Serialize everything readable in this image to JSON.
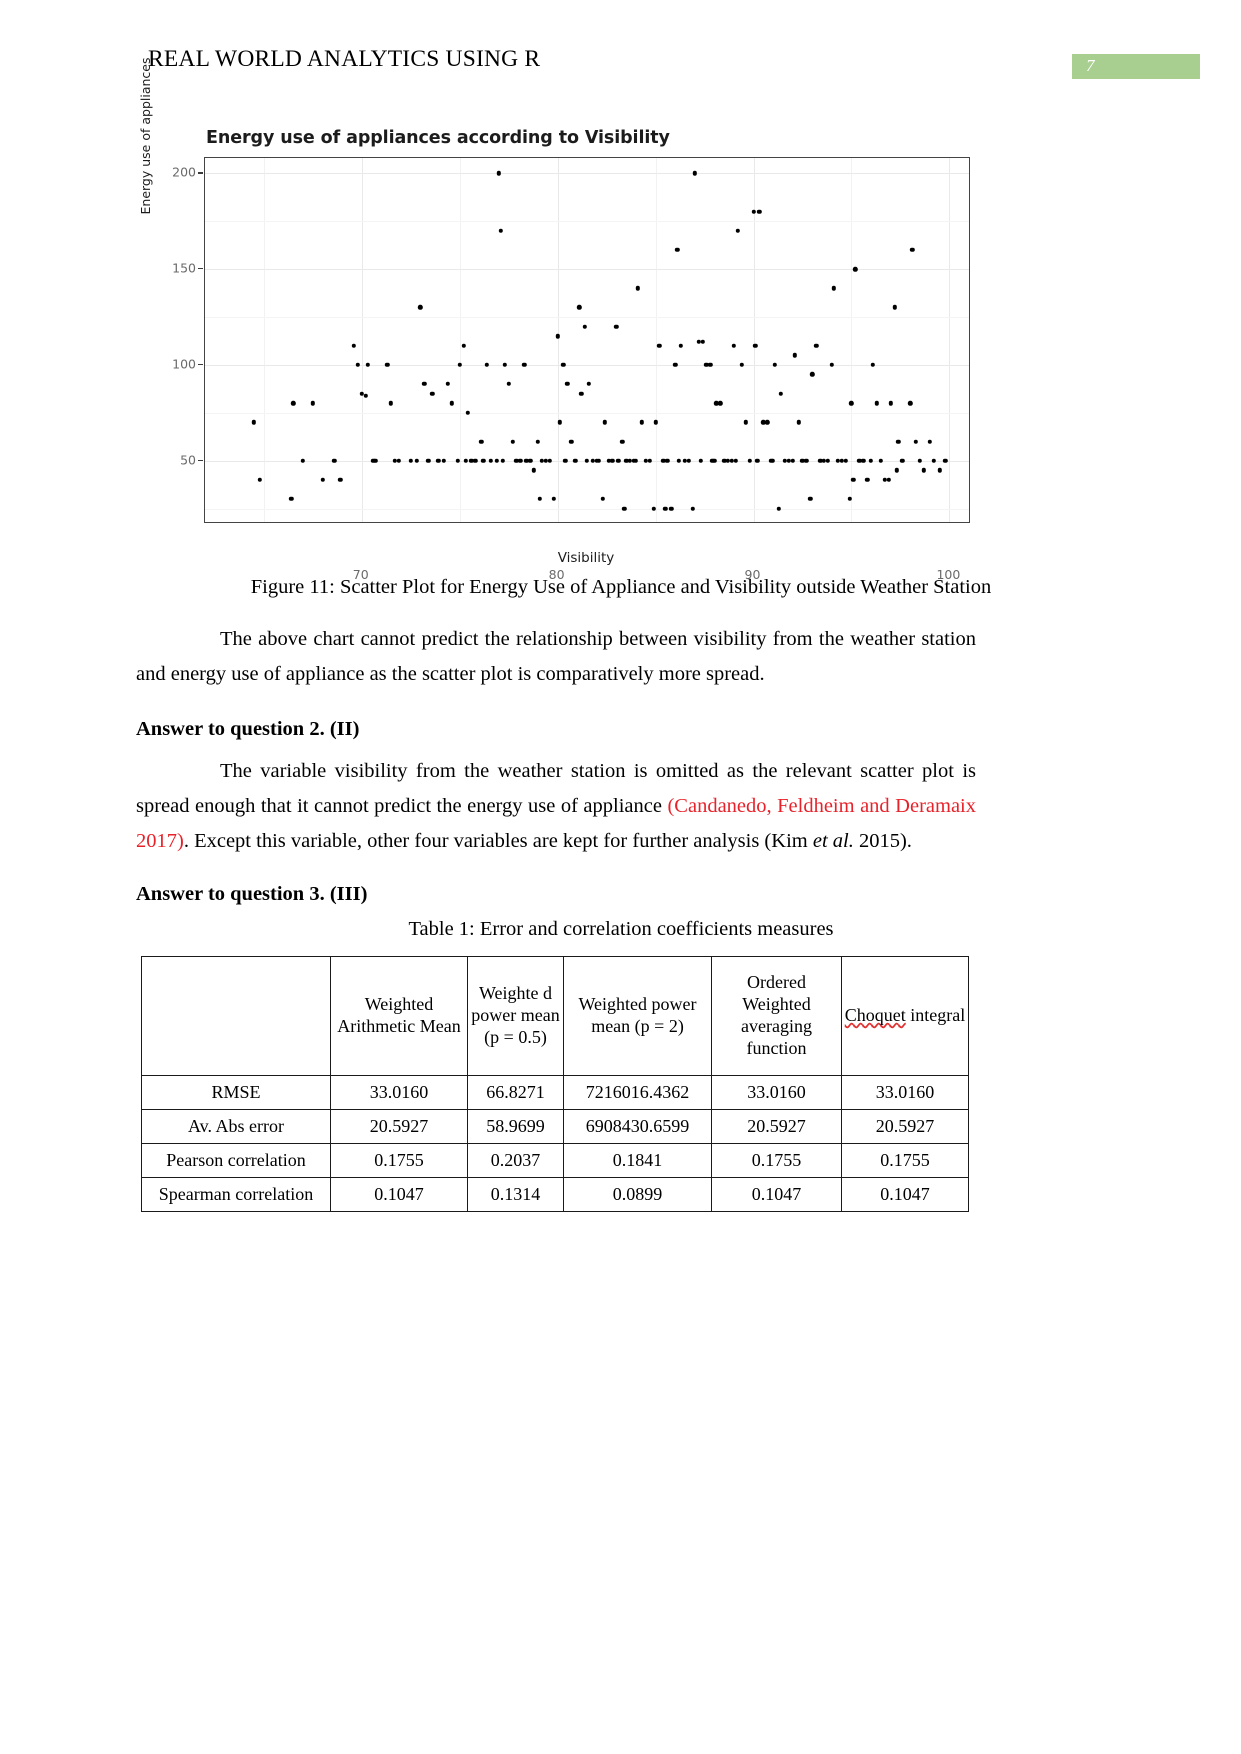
{
  "header": {
    "title": "REAL WORLD ANALYTICS USING R",
    "page_number": "7",
    "badge_color": "#a8ce90"
  },
  "chart_data": {
    "type": "scatter",
    "title": "Energy use of appliances according to Visibility",
    "xlabel": "Visibility",
    "ylabel": "Energy use of appliances",
    "xlim": [
      62,
      101
    ],
    "ylim": [
      18,
      208
    ],
    "xticks": [
      "70",
      "80",
      "90",
      "100"
    ],
    "xtick_values": [
      70,
      80,
      90,
      100
    ],
    "yticks": [
      "50",
      "100",
      "150",
      "200"
    ],
    "ytick_values": [
      50,
      100,
      150,
      200
    ],
    "grid": true,
    "legend": "none",
    "points": [
      [
        64.5,
        70
      ],
      [
        64.8,
        40
      ],
      [
        66.5,
        80
      ],
      [
        67.5,
        80
      ],
      [
        67.0,
        50
      ],
      [
        66.4,
        30
      ],
      [
        68.6,
        50
      ],
      [
        68.0,
        40
      ],
      [
        68.9,
        40
      ],
      [
        69.6,
        110
      ],
      [
        69.8,
        100
      ],
      [
        70.3,
        100
      ],
      [
        70.0,
        85
      ],
      [
        70.2,
        84
      ],
      [
        70.6,
        50
      ],
      [
        70.7,
        50
      ],
      [
        71.3,
        100
      ],
      [
        71.5,
        80
      ],
      [
        71.9,
        50
      ],
      [
        71.7,
        50
      ],
      [
        72.5,
        50
      ],
      [
        72.8,
        50
      ],
      [
        73.0,
        130
      ],
      [
        73.2,
        90
      ],
      [
        73.6,
        85
      ],
      [
        73.4,
        50
      ],
      [
        73.9,
        50
      ],
      [
        74.4,
        90
      ],
      [
        74.6,
        80
      ],
      [
        74.2,
        50
      ],
      [
        74.9,
        50
      ],
      [
        75.2,
        110
      ],
      [
        75.0,
        100
      ],
      [
        75.4,
        75
      ],
      [
        75.6,
        50
      ],
      [
        75.3,
        50
      ],
      [
        75.8,
        50
      ],
      [
        76.1,
        60
      ],
      [
        76.4,
        100
      ],
      [
        76.6,
        50
      ],
      [
        76.2,
        50
      ],
      [
        76.9,
        50
      ],
      [
        77.0,
        200
      ],
      [
        77.1,
        170
      ],
      [
        77.3,
        100
      ],
      [
        77.5,
        90
      ],
      [
        77.7,
        60
      ],
      [
        77.2,
        50
      ],
      [
        77.9,
        50
      ],
      [
        78.1,
        50
      ],
      [
        78.3,
        100
      ],
      [
        78.6,
        50
      ],
      [
        78.4,
        50
      ],
      [
        78.8,
        45
      ],
      [
        79.0,
        60
      ],
      [
        79.2,
        50
      ],
      [
        79.4,
        50
      ],
      [
        79.6,
        50
      ],
      [
        79.1,
        30
      ],
      [
        79.8,
        30
      ],
      [
        80.0,
        115
      ],
      [
        80.3,
        100
      ],
      [
        80.5,
        90
      ],
      [
        80.1,
        70
      ],
      [
        80.7,
        60
      ],
      [
        80.4,
        50
      ],
      [
        80.9,
        50
      ],
      [
        81.1,
        130
      ],
      [
        81.4,
        120
      ],
      [
        81.6,
        90
      ],
      [
        81.2,
        85
      ],
      [
        81.8,
        50
      ],
      [
        81.5,
        50
      ],
      [
        82.1,
        50
      ],
      [
        82.4,
        70
      ],
      [
        82.0,
        50
      ],
      [
        82.6,
        50
      ],
      [
        82.8,
        50
      ],
      [
        82.3,
        30
      ],
      [
        83.0,
        120
      ],
      [
        83.3,
        60
      ],
      [
        83.1,
        50
      ],
      [
        83.5,
        50
      ],
      [
        83.7,
        50
      ],
      [
        83.9,
        50
      ],
      [
        83.4,
        25
      ],
      [
        84.1,
        140
      ],
      [
        84.3,
        70
      ],
      [
        84.0,
        50
      ],
      [
        84.5,
        50
      ],
      [
        84.7,
        50
      ],
      [
        84.9,
        25
      ],
      [
        85.2,
        110
      ],
      [
        85.0,
        70
      ],
      [
        85.4,
        50
      ],
      [
        85.6,
        50
      ],
      [
        85.5,
        25
      ],
      [
        85.8,
        25
      ],
      [
        86.1,
        160
      ],
      [
        86.3,
        110
      ],
      [
        86.0,
        100
      ],
      [
        86.5,
        50
      ],
      [
        86.2,
        50
      ],
      [
        86.7,
        50
      ],
      [
        86.9,
        25
      ],
      [
        87.0,
        200
      ],
      [
        87.2,
        112
      ],
      [
        87.4,
        112
      ],
      [
        87.6,
        100
      ],
      [
        87.8,
        100
      ],
      [
        87.3,
        50
      ],
      [
        87.9,
        50
      ],
      [
        88.1,
        80
      ],
      [
        88.3,
        80
      ],
      [
        88.0,
        50
      ],
      [
        88.5,
        50
      ],
      [
        88.7,
        50
      ],
      [
        88.9,
        50
      ],
      [
        89.2,
        170
      ],
      [
        89.0,
        110
      ],
      [
        89.4,
        100
      ],
      [
        89.6,
        70
      ],
      [
        89.1,
        50
      ],
      [
        89.8,
        50
      ],
      [
        90.0,
        180
      ],
      [
        90.3,
        180
      ],
      [
        90.1,
        110
      ],
      [
        90.5,
        70
      ],
      [
        90.7,
        70
      ],
      [
        90.2,
        50
      ],
      [
        90.9,
        50
      ],
      [
        91.1,
        100
      ],
      [
        91.4,
        85
      ],
      [
        91.0,
        50
      ],
      [
        91.6,
        50
      ],
      [
        91.8,
        50
      ],
      [
        91.3,
        25
      ],
      [
        92.1,
        105
      ],
      [
        92.3,
        70
      ],
      [
        92.0,
        50
      ],
      [
        92.5,
        50
      ],
      [
        92.7,
        50
      ],
      [
        92.9,
        30
      ],
      [
        93.2,
        110
      ],
      [
        93.0,
        95
      ],
      [
        93.4,
        50
      ],
      [
        93.6,
        50
      ],
      [
        93.8,
        50
      ],
      [
        94.1,
        140
      ],
      [
        94.0,
        100
      ],
      [
        94.3,
        50
      ],
      [
        94.5,
        50
      ],
      [
        94.7,
        50
      ],
      [
        94.9,
        30
      ],
      [
        95.2,
        150
      ],
      [
        95.0,
        80
      ],
      [
        95.4,
        50
      ],
      [
        95.6,
        50
      ],
      [
        95.1,
        40
      ],
      [
        95.8,
        40
      ],
      [
        96.1,
        100
      ],
      [
        96.3,
        80
      ],
      [
        96.0,
        50
      ],
      [
        96.5,
        50
      ],
      [
        96.7,
        40
      ],
      [
        96.9,
        40
      ],
      [
        97.2,
        130
      ],
      [
        97.0,
        80
      ],
      [
        97.4,
        60
      ],
      [
        97.6,
        50
      ],
      [
        97.3,
        45
      ],
      [
        98.1,
        160
      ],
      [
        98.0,
        80
      ],
      [
        98.3,
        60
      ],
      [
        98.5,
        50
      ],
      [
        98.7,
        45
      ],
      [
        99.0,
        60
      ],
      [
        99.2,
        50
      ],
      [
        99.5,
        45
      ],
      [
        99.8,
        50
      ]
    ]
  },
  "figure_caption": "Figure 11: Scatter Plot for Energy Use of Appliance and Visibility outside Weather Station",
  "paragraph_1": {
    "text": "The above chart cannot predict the relationship between visibility from the weather station and energy use of appliance as the scatter plot is comparatively more spread."
  },
  "heading_2": "Answer to question 2. (II)",
  "paragraph_2": {
    "part_1": "The variable visibility from the weather station is omitted as the relevant scatter plot is spread enough that it cannot predict the energy use of appliance ",
    "citation_red": "(Candanedo, Feldheim and Deramaix 2017)",
    "part_2": ". Except this variable, other four variables are kept for further analysis (Kim ",
    "italic_part": "et al.",
    "part_3": " 2015)."
  },
  "heading_3": "Answer to question 3. (III)",
  "table_caption": "Table 1: Error and correlation coefficients measures",
  "table": {
    "headers": [
      "",
      "Weighted Arithmetic Mean",
      "Weighte d power mean (p = 0.5)",
      "Weighted power mean (p = 2)",
      "Ordered Weighted averaging function",
      "Choquet integral"
    ],
    "rows": [
      {
        "label": "RMSE",
        "values": [
          "33.0160",
          "66.8271",
          "7216016.4362",
          "33.0160",
          "33.0160"
        ]
      },
      {
        "label": "Av. Abs error",
        "values": [
          "20.5927",
          "58.9699",
          "6908430.6599",
          "20.5927",
          "20.5927"
        ]
      },
      {
        "label": "Pearson correlation",
        "values": [
          "0.1755",
          "0.2037",
          "0.1841",
          "0.1755",
          "0.1755"
        ]
      },
      {
        "label": "Spearman correlation",
        "values": [
          "0.1047",
          "0.1314",
          "0.0899",
          "0.1047",
          "0.1047"
        ]
      }
    ]
  }
}
